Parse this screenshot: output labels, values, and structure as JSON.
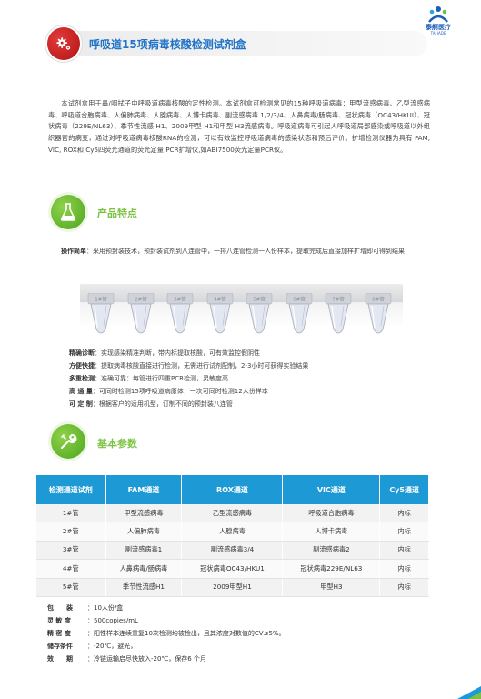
{
  "brand": {
    "name": "泰舸医疗",
    "sub": "TAI JADE"
  },
  "title": "呼吸道15项病毒核酸检测试剂盒",
  "intro": "本试剂盒用于鼻/咽拭子中呼吸道病毒核酸的定性检测。本试剂盒可检测常见的15种呼吸道病毒：甲型流感病毒、乙型流感病毒、呼吸道合胞病毒、人偏肺病毒、人腺病毒、人博卡病毒、副流感病毒 1/2/3/4、人鼻病毒/肠病毒、冠状病毒（OC43/HKUI）、冠状病毒（229E/NL63）、季节性流感 H1、2009甲型 H1和甲型 H3流感病毒。呼吸道病毒可引起人呼吸道局部感染或呼吸道以外组织器官的病变，通过对呼吸道病毒核酸RNA的检测，可以有效监控呼吸道病毒的感染状态和预后评价。扩增检测仪器为具有 FAM, VIC, ROX和 Cy5四荧光通道的荧光定量 PCR扩增仪,如ABI7500荧光定量PCR仪。",
  "features_section": {
    "title": "产品特点",
    "operation_label": "操作简单",
    "operation_text": "：采用预封装技术，预封装试剂到八连管中，一排八连管检测一人份样本，提取完成后直接加样扩增即可得到结果",
    "tube_labels": [
      "1#管",
      "2#管",
      "3#管",
      "4#管",
      "5#管",
      "6#管",
      "7#管",
      "8#管"
    ],
    "items": [
      {
        "label": "精确诊断",
        "text": "：实现感染精准判断，带内标提取核酸，可有效监控假阴性"
      },
      {
        "label": "方便快捷",
        "text": "：提取病毒核酸直接进行检测，无需进行试剂配制，2-3小时可获得实验结果"
      },
      {
        "label": "多重检测",
        "text": "：准确可靠：每管进行四重PCR检测，灵敏度高"
      },
      {
        "label": "高 通 量",
        "text": "：可同时检测15项呼吸道病原体，一次可同时检测12人份样本"
      },
      {
        "label": "可 定 制",
        "text": "：根据客户的适用机型，订制不同的预封装八连管"
      }
    ]
  },
  "params_section": {
    "title": "基本参数",
    "headers": [
      "检测通道试剂",
      "FAM通道",
      "ROX通道",
      "VIC通道",
      "Cy5通道"
    ],
    "rows": [
      [
        "1#管",
        "甲型流感病毒",
        "乙型流感病毒",
        "呼吸道合胞病毒",
        "内标"
      ],
      [
        "2#管",
        "人偏肺病毒",
        "人腺病毒",
        "人博卡病毒",
        "内标"
      ],
      [
        "3#管",
        "副流感病毒1",
        "副流感病毒3/4",
        "副流感病毒2",
        "内标"
      ],
      [
        "4#管",
        "人鼻病毒/肠病毒",
        "冠状病毒OC43/HKU1",
        "冠状病毒229E/NL63",
        "内标"
      ],
      [
        "5#管",
        "季节性流感H1",
        "2009甲型H1",
        "甲型H3",
        "内标"
      ]
    ]
  },
  "specs": [
    {
      "label": "包　　装",
      "value": "：10人份/盒"
    },
    {
      "label": "灵 敏 度",
      "value": "：500copies/mL"
    },
    {
      "label": "精 密 度",
      "value": "：阳性样本连续重复10次检测均被检出，且其浓度对数值的CV≤5%。"
    },
    {
      "label": "储存条件",
      "value": "：-20℃，避光，"
    },
    {
      "label": "效　　期",
      "value": "：冷链运输启尽快放入-20℃，保存6 个月"
    }
  ],
  "colors": {
    "title_blue": "#2173c8",
    "accent_green": "#7cc242",
    "table_header": "#1d9ad6",
    "title_icon_red": "#c81e1e"
  },
  "icons": {
    "title": "gear-icon",
    "features": "flask-icon",
    "params": "wrench-icon",
    "brand": "people-logo-icon"
  }
}
